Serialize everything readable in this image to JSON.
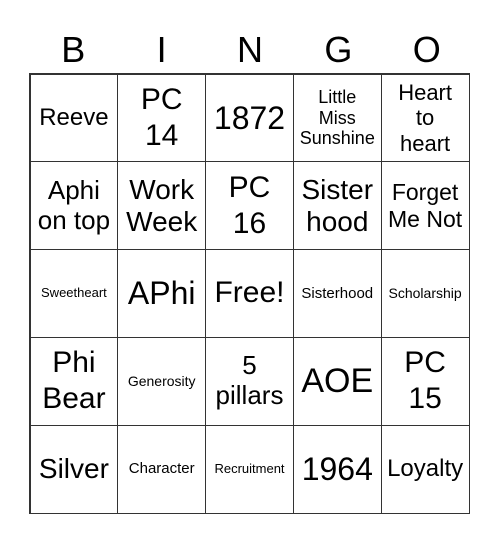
{
  "header": [
    "B",
    "I",
    "N",
    "G",
    "O"
  ],
  "cells": [
    "Reeve",
    "PC 14",
    "1872",
    "Little Miss Sunshine",
    "Heart to heart",
    "Aphi on top",
    "Work Week",
    "PC 16",
    "Sister hood",
    "Forget Me Not",
    "Sweetheart",
    "APhi",
    "Free!",
    "Sisterhood",
    "Scholarship",
    "Phi Bear",
    "Generosity",
    "5 pillars",
    "AOE",
    "PC 15",
    "Silver",
    "Character",
    "Recruitment",
    "1964",
    "Loyalty"
  ]
}
